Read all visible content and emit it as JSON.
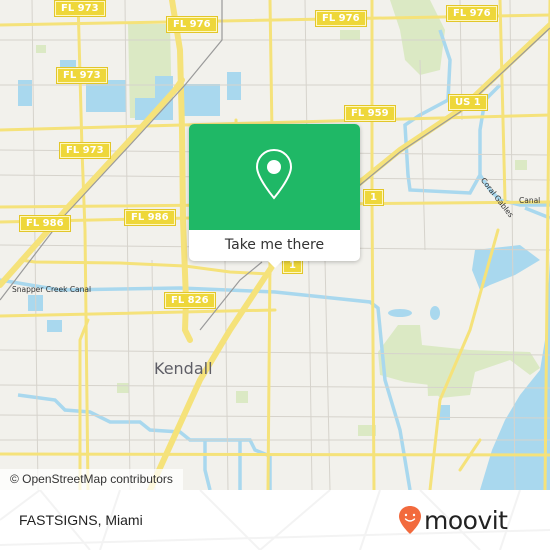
{
  "map": {
    "colors": {
      "land": "#f2f1ec",
      "water": "#a9d8ee",
      "park": "#dbe9c4",
      "road": "#f5e27a",
      "minor_road": "#d6d3cc",
      "shield": "#eed73a"
    },
    "route_shields": [
      {
        "id": "fl973-top",
        "label": "FL 973"
      },
      {
        "id": "fl976-a",
        "label": "FL 976"
      },
      {
        "id": "fl976-b",
        "label": "FL 976"
      },
      {
        "id": "fl976-c",
        "label": "FL 976"
      },
      {
        "id": "fl973-mid",
        "label": "FL 973"
      },
      {
        "id": "fl959",
        "label": "FL 959"
      },
      {
        "id": "us1-a",
        "label": "US 1"
      },
      {
        "id": "fl973-low",
        "label": "FL 973"
      },
      {
        "id": "fl986-a",
        "label": "FL 986"
      },
      {
        "id": "fl986-b",
        "label": "FL 986"
      },
      {
        "id": "us1-b",
        "label": "1"
      },
      {
        "id": "us1-c",
        "label": "1"
      },
      {
        "id": "fl826",
        "label": "FL 826"
      }
    ],
    "place_labels": {
      "kendall": "Kendall"
    },
    "canal_labels": {
      "snapper_creek": "Snapper Creek Canal",
      "coral_gables_a": "Coral Gables",
      "coral_gables_b": "Canal"
    },
    "attribution": "© OpenStreetMap contributors"
  },
  "popup": {
    "icon": "map-pin-icon",
    "button_label": "Take me there",
    "color": "#1fb866"
  },
  "footer": {
    "place_title": "FASTSIGNS, Miami",
    "brand": "moovit",
    "brand_color": "#f26a3d"
  }
}
